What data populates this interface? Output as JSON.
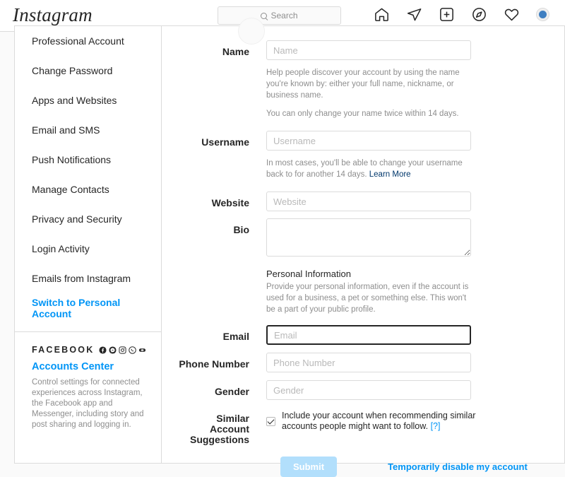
{
  "topnav": {
    "brand": "Instagram",
    "search": {
      "placeholder": "Search",
      "value": "",
      "icon": "search-icon"
    },
    "icons": [
      {
        "name": "home-icon",
        "label": "Home"
      },
      {
        "name": "paper-plane-icon",
        "label": "Direct"
      },
      {
        "name": "plus-box-icon",
        "label": "New Post"
      },
      {
        "name": "compass-icon",
        "label": "Explore"
      },
      {
        "name": "heart-icon",
        "label": "Activity"
      }
    ],
    "avatar_label": "Profile"
  },
  "sidebar": {
    "items": [
      {
        "label": "Professional Account",
        "active": false
      },
      {
        "label": "Change Password",
        "active": false
      },
      {
        "label": "Apps and Websites",
        "active": false
      },
      {
        "label": "Email and SMS",
        "active": false
      },
      {
        "label": "Push Notifications",
        "active": false
      },
      {
        "label": "Manage Contacts",
        "active": false
      },
      {
        "label": "Privacy and Security",
        "active": false
      },
      {
        "label": "Login Activity",
        "active": false
      },
      {
        "label": "Emails from Instagram",
        "active": false
      },
      {
        "label": "Switch to Personal Account",
        "active": true
      }
    ],
    "facebook": {
      "title": "FACEBOOK",
      "icons": [
        "facebook-icon",
        "messenger-icon",
        "instagram-icon",
        "whatsapp-icon",
        "oculus-icon"
      ],
      "accounts_center": "Accounts Center",
      "description": "Control settings for connected experiences across Instagram, the Facebook app and Messenger, including story and post sharing and logging in."
    }
  },
  "form": {
    "name": {
      "label": "Name",
      "placeholder": "Name",
      "value": ""
    },
    "name_help_1": "Help people discover your account by using the name you're known by: either your full name, nickname, or business name.",
    "name_help_2": "You can only change your name twice within 14 days.",
    "username": {
      "label": "Username",
      "placeholder": "Username",
      "value": ""
    },
    "username_help": "In most cases, you'll be able to change your username back to for another 14 days.",
    "username_help_link": "Learn More",
    "website": {
      "label": "Website",
      "placeholder": "Website",
      "value": ""
    },
    "bio": {
      "label": "Bio",
      "placeholder": "",
      "value": ""
    },
    "personal_info_title": "Personal Information",
    "personal_info_desc": "Provide your personal information, even if the account is used for a business, a pet or something else. This won't be a part of your public profile.",
    "email": {
      "label": "Email",
      "placeholder": "Email",
      "value": "",
      "focused": true
    },
    "phone": {
      "label": "Phone Number",
      "placeholder": "Phone Number",
      "value": ""
    },
    "gender": {
      "label": "Gender",
      "placeholder": "Gender",
      "value": ""
    },
    "similar": {
      "label": "Similar Account Suggestions",
      "checkbox_checked": true,
      "text": "Include your account when recommending similar accounts people might want to follow.",
      "help_marker": "[?]"
    },
    "submit_label": "Submit",
    "disable_link": "Temporarily disable my account"
  },
  "colors": {
    "accent_blue": "#0095f6",
    "link_dark_blue": "#00376b",
    "submit_disabled": "#b2dffc",
    "border": "#dbdbdb",
    "muted_text": "#8e8e8e",
    "page_bg": "#fafafa"
  }
}
